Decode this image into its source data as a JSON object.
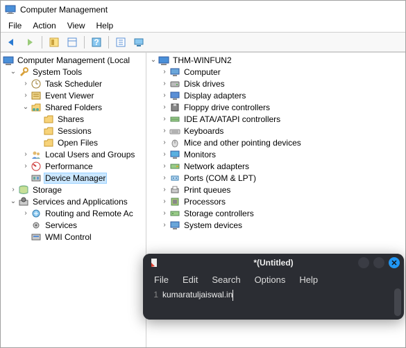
{
  "window": {
    "title": "Computer Management"
  },
  "menubar": [
    "File",
    "Action",
    "View",
    "Help"
  ],
  "leftTree": {
    "root": "Computer Management (Local",
    "systemTools": {
      "label": "System Tools",
      "children": {
        "taskScheduler": "Task Scheduler",
        "eventViewer": "Event Viewer",
        "sharedFolders": {
          "label": "Shared Folders",
          "children": {
            "shares": "Shares",
            "sessions": "Sessions",
            "openFiles": "Open Files"
          }
        },
        "localUsers": "Local Users and Groups",
        "performance": "Performance",
        "deviceManager": "Device Manager"
      }
    },
    "storage": "Storage",
    "services": {
      "label": "Services and Applications",
      "children": {
        "routing": "Routing and Remote Ac",
        "servicesItem": "Services",
        "wmi": "WMI Control"
      }
    }
  },
  "rightTree": {
    "root": "THM-WINFUN2",
    "items": [
      "Computer",
      "Disk drives",
      "Display adapters",
      "Floppy drive controllers",
      "IDE ATA/ATAPI controllers",
      "Keyboards",
      "Mice and other pointing devices",
      "Monitors",
      "Network adapters",
      "Ports (COM & LPT)",
      "Print queues",
      "Processors",
      "Storage controllers",
      "System devices"
    ]
  },
  "editor": {
    "title": "*(Untitled)",
    "menu": [
      "File",
      "Edit",
      "Search",
      "Options",
      "Help"
    ],
    "lineNum": "1",
    "text": "kumaratuljaiswal.in"
  }
}
